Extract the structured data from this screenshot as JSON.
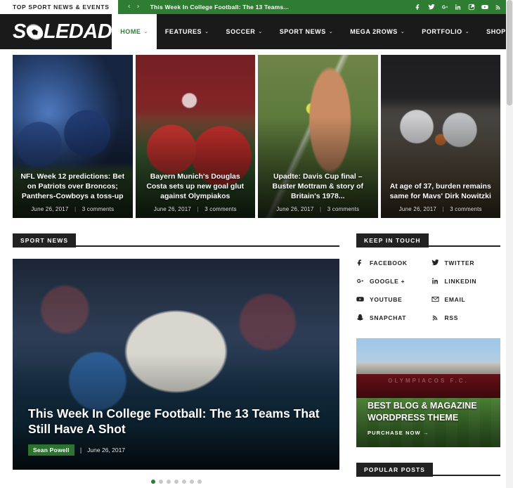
{
  "topbar": {
    "label": "TOP SPORT NEWS & EVENTS",
    "prev_arrow": "‹",
    "next_arrow": "›",
    "ticker_text": "This Week In College Football: The 13 Teams...",
    "social": [
      {
        "name": "facebook-icon",
        "title": "Facebook"
      },
      {
        "name": "twitter-icon",
        "title": "Twitter"
      },
      {
        "name": "google-plus-icon",
        "title": "Google Plus"
      },
      {
        "name": "linkedin-icon",
        "title": "LinkedIn"
      },
      {
        "name": "instagram-icon",
        "title": "Instagram"
      },
      {
        "name": "youtube-icon",
        "title": "YouTube"
      },
      {
        "name": "rss-icon",
        "title": "RSS"
      }
    ],
    "bg_color": "#2f7d32"
  },
  "header": {
    "logo_before": "S",
    "logo_after": "LEDAD",
    "logo_ball_icon": "soccer-ball-icon",
    "bg_color": "#1a1a1a",
    "nav": [
      {
        "label": "HOME",
        "caret": "⌄",
        "active": true
      },
      {
        "label": "FEATURES",
        "caret": "⌄",
        "active": false
      },
      {
        "label": "SOCCER",
        "caret": "⌄",
        "active": false
      },
      {
        "label": "SPORT NEWS",
        "caret": "⌄",
        "active": false
      },
      {
        "label": "MEGA 2ROWS",
        "caret": "⌄",
        "active": false
      },
      {
        "label": "PORTFOLIO",
        "caret": "⌄",
        "active": false
      },
      {
        "label": "SHOP",
        "caret": "",
        "active": false
      }
    ],
    "search_icon": "search-icon",
    "accent_color": "#2f7d32"
  },
  "slider": {
    "slides": [
      {
        "title": "NFL Week 12 predictions: Bet on Patriots over Broncos; Panthers-Cowboys a toss-up",
        "date": "June 26, 2017",
        "comments": "3 comments",
        "art": "ph-nfl"
      },
      {
        "title": "Bayern Munich's Douglas Costa sets up new goal glut against Olympiakos",
        "date": "June 26, 2017",
        "comments": "3 comments",
        "art": "ph-soccer"
      },
      {
        "title": "Upadte: Davis Cup final – Buster Mottram & story of Britain's 1978...",
        "date": "June 26, 2017",
        "comments": "3 comments",
        "art": "ph-tennis"
      },
      {
        "title": "At age of 37, burden remains same for Mavs' Dirk Nowitzki",
        "date": "June 26, 2017",
        "comments": "3 comments",
        "art": "ph-basket"
      }
    ],
    "separator": "|"
  },
  "main": {
    "section_title": "SPORT NEWS",
    "feature": {
      "title": "This Week In College Football: The 13 Teams That Still Have A Shot",
      "author": "Sean Powell",
      "separator": "|",
      "date": "June 26, 2017"
    },
    "pagination": {
      "total": 7,
      "active_index": 0
    }
  },
  "sidebar": {
    "keep_in_touch_title": "KEEP IN TOUCH",
    "socials": [
      {
        "label": "FACEBOOK",
        "icon": "facebook-icon"
      },
      {
        "label": "TWITTER",
        "icon": "twitter-icon"
      },
      {
        "label": "GOOGLE +",
        "icon": "google-plus-icon"
      },
      {
        "label": "LINKEDIN",
        "icon": "linkedin-icon"
      },
      {
        "label": "YOUTUBE",
        "icon": "youtube-icon"
      },
      {
        "label": "EMAIL",
        "icon": "email-icon"
      },
      {
        "label": "SNAPCHAT",
        "icon": "snapchat-icon"
      },
      {
        "label": "RSS",
        "icon": "rss-icon"
      }
    ],
    "promo": {
      "stadium_text": "OLYMPIACOS F.C.",
      "headline": "BEST BLOG & MAGAZINE WORDPRESS THEME",
      "cta": "PURCHASE NOW  →"
    },
    "popular_posts_title": "POPULAR POSTS"
  }
}
